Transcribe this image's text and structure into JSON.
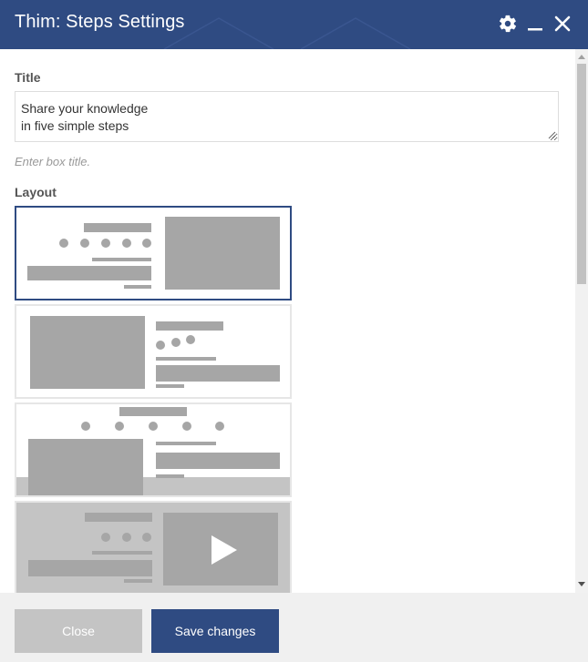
{
  "dialog": {
    "title": "Thim: Steps Settings",
    "icons": {
      "settings": "gear-icon",
      "minimize": "minimize-icon",
      "close": "close-icon"
    }
  },
  "form": {
    "title_label": "Title",
    "title_value_lines": [
      "Share your knowledge",
      "in five simple steps"
    ],
    "title_hint": "Enter box title.",
    "layout_label": "Layout",
    "layout_options": [
      {
        "id": "layout-1",
        "selected": true
      },
      {
        "id": "layout-2",
        "selected": false
      },
      {
        "id": "layout-3",
        "selected": false
      },
      {
        "id": "layout-4",
        "selected": false,
        "icon": "play-icon"
      }
    ]
  },
  "footer": {
    "close_label": "Close",
    "save_label": "Save changes"
  },
  "colors": {
    "header_bg": "#2f4b82",
    "primary_button": "#2f4b82",
    "secondary_button": "#c4c4c4",
    "placeholder_shape": "#a6a6a6"
  }
}
